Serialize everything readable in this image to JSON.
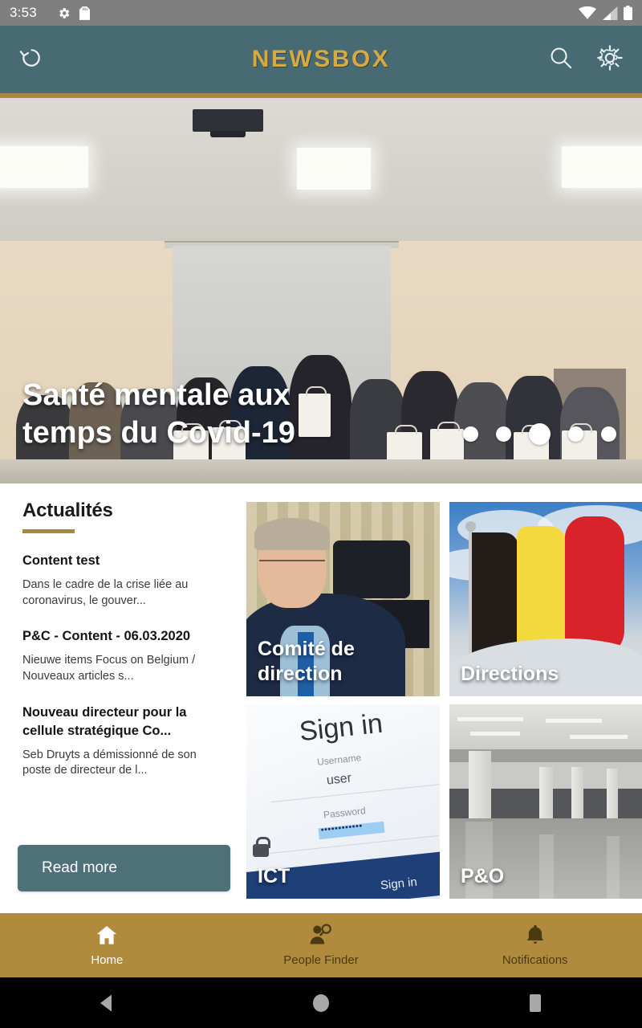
{
  "statusbar": {
    "time": "3:53",
    "icons_left": [
      "gear-icon",
      "sd-card-icon"
    ],
    "icons_right": [
      "wifi-icon",
      "cellular-signal-icon",
      "battery-icon"
    ]
  },
  "appbar": {
    "title": "NEWSBOX",
    "back_icon": "rotate-left-icon",
    "search_icon": "search-icon",
    "settings_icon": "gear-icon",
    "bg_color": "#476a73",
    "title_color": "#d7a93f",
    "accent_color": "#a9873f"
  },
  "hero": {
    "headline": "Santé mentale aux temps du Covid-19",
    "dots_total": 5,
    "active_dot": 3
  },
  "news": {
    "heading": "Actualités",
    "items": [
      {
        "title": "Content test",
        "summary": "Dans le cadre de la crise liée au coronavirus, le gouver..."
      },
      {
        "title": "P&C - Content - 06.03.2020",
        "summary": "Nieuwe items Focus on Belgium / Nouveaux articles s..."
      },
      {
        "title": "Nouveau directeur pour la cellule stratégique Co...",
        "summary": "Seb Druyts a démissionné de son poste de directeur de l..."
      }
    ],
    "read_more_label": "Read more",
    "read_more_color": "#4e7079"
  },
  "tiles": [
    {
      "label": "Comité de direction",
      "art": "portrait"
    },
    {
      "label": "Directions",
      "art": "belgian-flag"
    },
    {
      "label": "ICT",
      "art": "sign-in-screen"
    },
    {
      "label": "P&O",
      "art": "parking-garage"
    }
  ],
  "signin_art": {
    "heading": "Sign in",
    "username_label": "Username",
    "username_value": "user",
    "password_label": "Password",
    "button_label": "Sign in"
  },
  "bottomnav": {
    "bg_color": "#b08b3e",
    "items": [
      {
        "label": "Home",
        "icon": "home-icon",
        "active": true
      },
      {
        "label": "People Finder",
        "icon": "person-search-icon",
        "active": false
      },
      {
        "label": "Notifications",
        "icon": "bell-icon",
        "active": false
      }
    ]
  },
  "sysnav": {
    "back": "triangle-back-icon",
    "home": "circle-home-icon",
    "recents": "square-recents-icon"
  }
}
